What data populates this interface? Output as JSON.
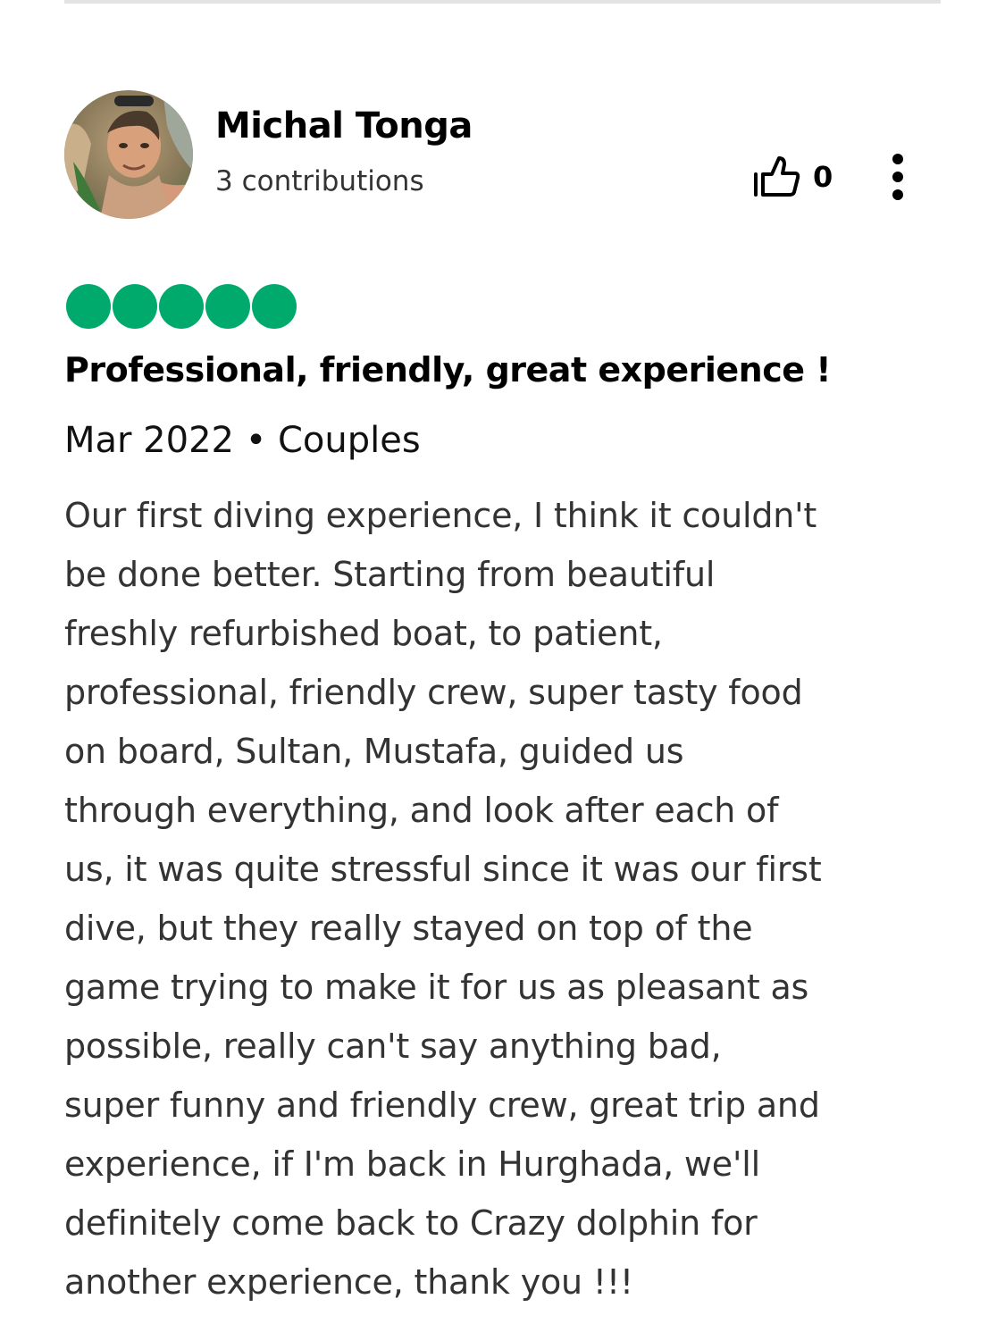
{
  "review": {
    "reviewer": {
      "name": "Michal Tonga",
      "contributions": "3 contributions",
      "avatar_icon": "user-avatar-photo"
    },
    "helpful": {
      "icon": "thumbs-up-icon",
      "count": "0"
    },
    "more_icon": "vertical-ellipsis-icon",
    "rating": {
      "value": 5,
      "max": 5,
      "bubble_color": "#00aa6c"
    },
    "title": "Professional, friendly, great experience !",
    "meta": "Mar 2022 • Couples",
    "body_lines": [
      "Our first diving experience, I think it couldn't",
      "be done better. Starting from beautiful",
      "freshly refurbished boat, to patient,",
      "professional, friendly crew, super tasty food",
      "on board, Sultan, Mustafa, guided us",
      "through everything, and look after each of",
      "us, it was quite stressful since it was our first",
      "dive, but they really stayed on top of the",
      "game trying to make it for us as pleasant as",
      "possible, really can't say anything bad,",
      "super funny and friendly crew, great trip and",
      "experience, if I'm back in Hurghada, we'll",
      "definitely come back to Crazy dolphin for",
      "another experience, thank you !!!"
    ]
  }
}
